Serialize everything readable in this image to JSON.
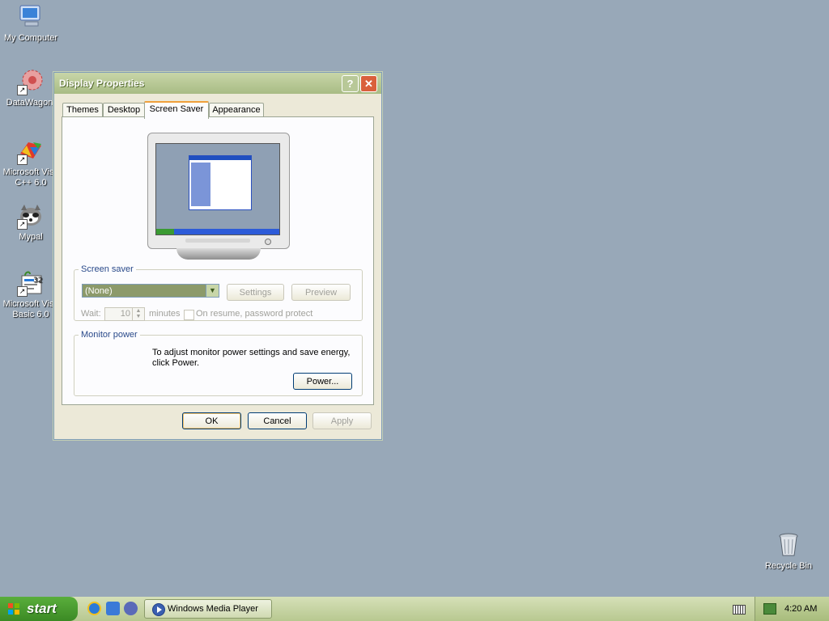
{
  "desktop": {
    "icons": [
      {
        "label": "My Computer"
      },
      {
        "label": "DataWagon."
      },
      {
        "label_line1": "Microsoft Visu",
        "label_line2": "C++ 6.0"
      },
      {
        "label": "Mypal"
      },
      {
        "label_line1": "Microsoft Visu",
        "label_line2": "Basic 6.0"
      }
    ],
    "recycle_bin": {
      "label": "Recycle Bin"
    }
  },
  "dialog": {
    "title": "Display Properties",
    "help_glyph": "?",
    "close_glyph": "✕",
    "tabs": [
      {
        "label": "Themes"
      },
      {
        "label": "Desktop"
      },
      {
        "label": "Screen Saver",
        "active": true
      },
      {
        "label": "Appearance"
      }
    ],
    "screen_saver": {
      "legend": "Screen saver",
      "selected": "(None)",
      "settings_label": "Settings",
      "preview_label": "Preview",
      "wait_label": "Wait:",
      "wait_value": "10",
      "minutes_label": "minutes",
      "password_label": "On resume, password protect"
    },
    "monitor_power": {
      "legend": "Monitor power",
      "text_line1": "To adjust monitor power settings and save energy,",
      "text_line2": "click Power.",
      "power_label": "Power..."
    },
    "buttons": {
      "ok": "OK",
      "cancel": "Cancel",
      "apply": "Apply"
    }
  },
  "taskbar": {
    "start_label": "start",
    "task_button": "Windows Media Player",
    "clock": "4:20 AM"
  },
  "colors": {
    "desktop": "#98a8b8",
    "titlebar": "#b0c28c",
    "start_button": "#4a9a30",
    "active_tab_accent": "#f0a03c"
  }
}
